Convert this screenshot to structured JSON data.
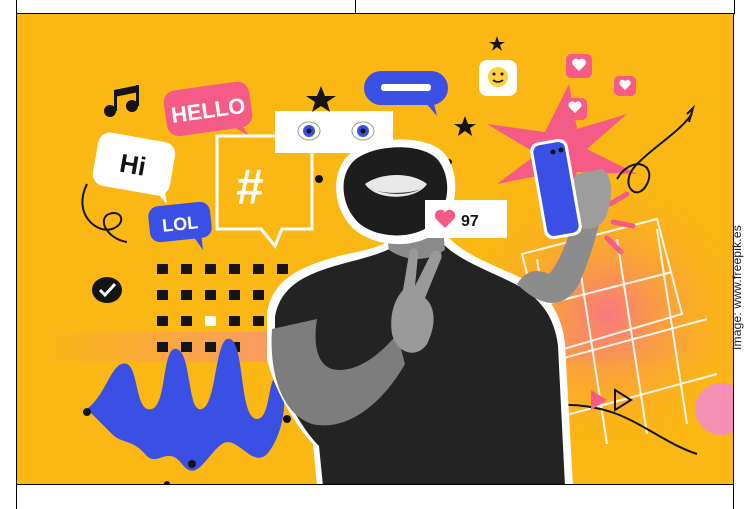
{
  "image": {
    "bubbles": {
      "hello": "HELLO",
      "hi": "Hi",
      "lol": "LOL",
      "hashtag": "#"
    },
    "like_counter": {
      "icon": "heart-icon",
      "count": "97"
    },
    "credit": "Image: www.freepik.es"
  },
  "colors": {
    "background": "#fbb714",
    "pink": "#f45b86",
    "blue": "#3a50e4",
    "dark": "#141414",
    "white": "#ffffff"
  }
}
